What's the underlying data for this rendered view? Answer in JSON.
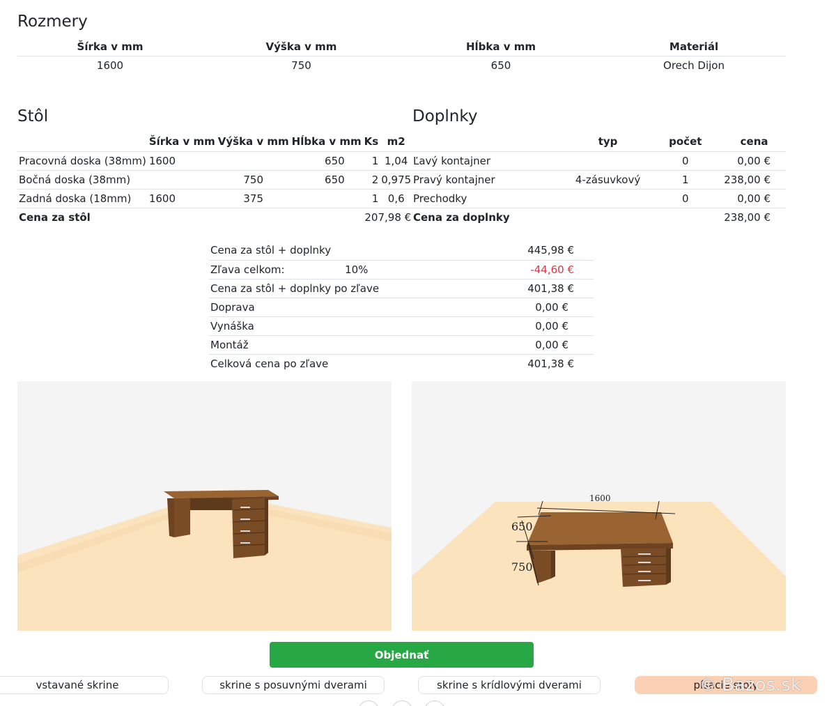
{
  "rozmery": {
    "title": "Rozmery",
    "headers": [
      "Šírka v mm",
      "Výška v mm",
      "Hĺbka v mm",
      "Materiál"
    ],
    "values": [
      "1600",
      "750",
      "650",
      "Orech Dijon"
    ]
  },
  "stol": {
    "title": "Stôl",
    "headers": [
      "",
      "Šírka v mm",
      "Výška v mm",
      "Hĺbka v mm",
      "Ks",
      "m2"
    ],
    "rows": [
      [
        "Pracovná doska (38mm)",
        "1600",
        "",
        "650",
        "1",
        "1,04"
      ],
      [
        "Bočná doska (38mm)",
        "",
        "750",
        "650",
        "2",
        "0,975"
      ],
      [
        "Zadná doska (18mm)",
        "1600",
        "375",
        "",
        "1",
        "0,6"
      ]
    ],
    "total_label": "Cena za stôl",
    "total_value": "207,98 €"
  },
  "doplnky": {
    "title": "Doplnky",
    "headers": [
      "",
      "typ",
      "počet",
      "cena"
    ],
    "rows": [
      [
        "Ľavý kontajner",
        "",
        "0",
        "0,00 €"
      ],
      [
        "Pravý kontajner",
        "4-zásuvkový",
        "1",
        "238,00 €"
      ],
      [
        "Prechodky",
        "",
        "0",
        "0,00 €"
      ]
    ],
    "total_label": "Cena za doplnky",
    "total_value": "238,00 €"
  },
  "summary": {
    "rows": [
      {
        "label": "Cena za stôl + doplnky",
        "extra": "",
        "value": "445,98 €"
      },
      {
        "label": "Zľava celkom:",
        "extra": "10%",
        "value": "-44,60 €"
      },
      {
        "label": "Cena za stôl + doplnky po zľave",
        "extra": "",
        "value": "401,38 €"
      },
      {
        "label": "Doprava",
        "extra": "",
        "value": "0,00 €"
      },
      {
        "label": "Vynáška",
        "extra": "",
        "value": "0,00 €"
      },
      {
        "label": "Montáž",
        "extra": "",
        "value": "0,00 €"
      },
      {
        "label": "Celková cena po zľave",
        "extra": "",
        "value": "401,38 €"
      }
    ]
  },
  "view2_dims": {
    "width": "1600",
    "depth": "650",
    "height": "750"
  },
  "order_button": "Objednať",
  "categories": [
    "vstavané skrine",
    "skrine s posuvnými dverami",
    "skrine s krídlovými dverami",
    "písacie stoly"
  ],
  "watermark": "Bazos.sk",
  "colors": {
    "primary_green": "#28a745",
    "discount_red": "#dc3545",
    "active_category": "#fbd0b4",
    "wood": "#8b5a2b",
    "floor": "#fbe3bd"
  }
}
